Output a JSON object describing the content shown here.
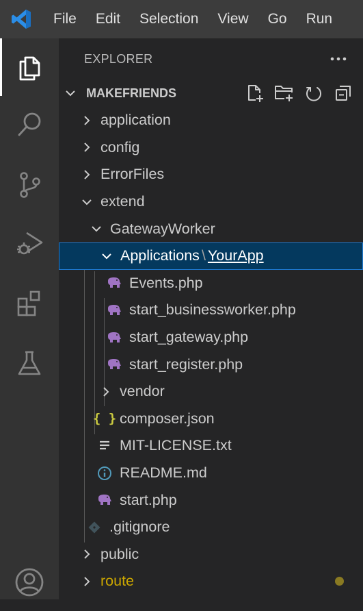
{
  "menu": [
    "File",
    "Edit",
    "Selection",
    "View",
    "Go",
    "Run"
  ],
  "activity": {
    "items": [
      "explorer-icon",
      "search-icon",
      "source-control-icon",
      "run-debug-icon",
      "extensions-icon",
      "testing-icon",
      "accounts-icon"
    ],
    "active": "explorer-icon"
  },
  "sidebar": {
    "title": "EXPLORER",
    "more": "...",
    "section_title": "MAKEFRIENDS"
  },
  "tree": [
    {
      "label": "application",
      "type": "folder",
      "expanded": false
    },
    {
      "label": "config",
      "type": "folder",
      "expanded": false
    },
    {
      "label": "ErrorFiles",
      "type": "folder",
      "expanded": false
    },
    {
      "label": "extend",
      "type": "folder",
      "expanded": true
    },
    {
      "label": "GatewayWorker",
      "type": "folder",
      "expanded": true
    },
    {
      "label_parts": [
        "Applications",
        "\\",
        "YourApp"
      ],
      "type": "folder",
      "expanded": true,
      "selected": true
    },
    {
      "label": "Events.php",
      "type": "php"
    },
    {
      "label": "start_businessworker.php",
      "type": "php"
    },
    {
      "label": "start_gateway.php",
      "type": "php"
    },
    {
      "label": "start_register.php",
      "type": "php"
    },
    {
      "label": "vendor",
      "type": "folder",
      "expanded": false
    },
    {
      "label": "composer.json",
      "type": "json",
      "icon_text": "{ }"
    },
    {
      "label": "MIT-LICENSE.txt",
      "type": "txt"
    },
    {
      "label": "README.md",
      "type": "md"
    },
    {
      "label": "start.php",
      "type": "php"
    },
    {
      "label": ".gitignore",
      "type": "git"
    },
    {
      "label": "public",
      "type": "folder",
      "expanded": false
    },
    {
      "label": "route",
      "type": "folder",
      "expanded": false,
      "modified": true
    }
  ],
  "colors": {
    "titlebar": "#3c3c3c",
    "activitybar": "#333333",
    "sidebar": "#252526",
    "selection": "#04395e",
    "focus_border": "#1f7ad1",
    "php_icon": "#a074c4",
    "json_icon": "#cbcb41",
    "md_icon": "#519aba",
    "modified": "#cca700"
  }
}
